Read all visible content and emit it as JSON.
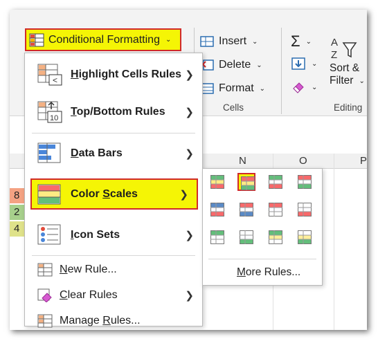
{
  "ribbon": {
    "conditional_formatting": "Conditional Formatting",
    "insert": "Insert",
    "delete": "Delete",
    "format": "Format",
    "cells_group": "Cells",
    "sort_filter_line1": "Sort &",
    "sort_filter_line2": "Filter",
    "editing_group": "Editing",
    "sum_icon": "Σ"
  },
  "sheet": {
    "columns": [
      "N",
      "O",
      "P"
    ],
    "row_values": [
      "8",
      "2",
      "4"
    ],
    "row_colors": [
      "#f4a283",
      "#a7d08c",
      "#dfe28a"
    ]
  },
  "menu": {
    "items": [
      {
        "label": "Highlight Cells Rules",
        "icon": "highlight-cells-icon"
      },
      {
        "label": "Top/Bottom Rules",
        "icon": "top-bottom-icon"
      },
      {
        "label": "Data Bars",
        "icon": "data-bars-icon"
      },
      {
        "label": "Color Scales",
        "icon": "color-scales-icon"
      },
      {
        "label": "Icon Sets",
        "icon": "icon-sets-icon"
      },
      {
        "label": "New Rule...",
        "icon": "new-rule-icon"
      },
      {
        "label": "Clear Rules",
        "icon": "clear-rules-icon"
      },
      {
        "label": "Manage Rules...",
        "icon": "manage-rules-icon"
      }
    ]
  },
  "submenu": {
    "more_rules": "More Rules...",
    "selected_index": 1,
    "swatches": [
      [
        "#63be7b",
        "#ffeb84",
        "#f8696b"
      ],
      [
        "#f8696b",
        "#ffeb84",
        "#63be7b"
      ],
      [
        "#63be7b",
        "#fcfcff",
        "#f8696b"
      ],
      [
        "#f8696b",
        "#fcfcff",
        "#63be7b"
      ],
      [
        "#5a8ac6",
        "#fcfcff",
        "#f8696b"
      ],
      [
        "#f8696b",
        "#fcfcff",
        "#5a8ac6"
      ],
      [
        "#f8696b",
        "#fcfcff",
        "#ffffff"
      ],
      [
        "#ffffff",
        "#fcfcff",
        "#f8696b"
      ],
      [
        "#63be7b",
        "#fcfcff",
        "#ffffff"
      ],
      [
        "#ffffff",
        "#fcfcff",
        "#63be7b"
      ],
      [
        "#63be7b",
        "#ffef9c",
        "#ffffff"
      ],
      [
        "#ffffff",
        "#ffef9c",
        "#63be7b"
      ]
    ]
  }
}
